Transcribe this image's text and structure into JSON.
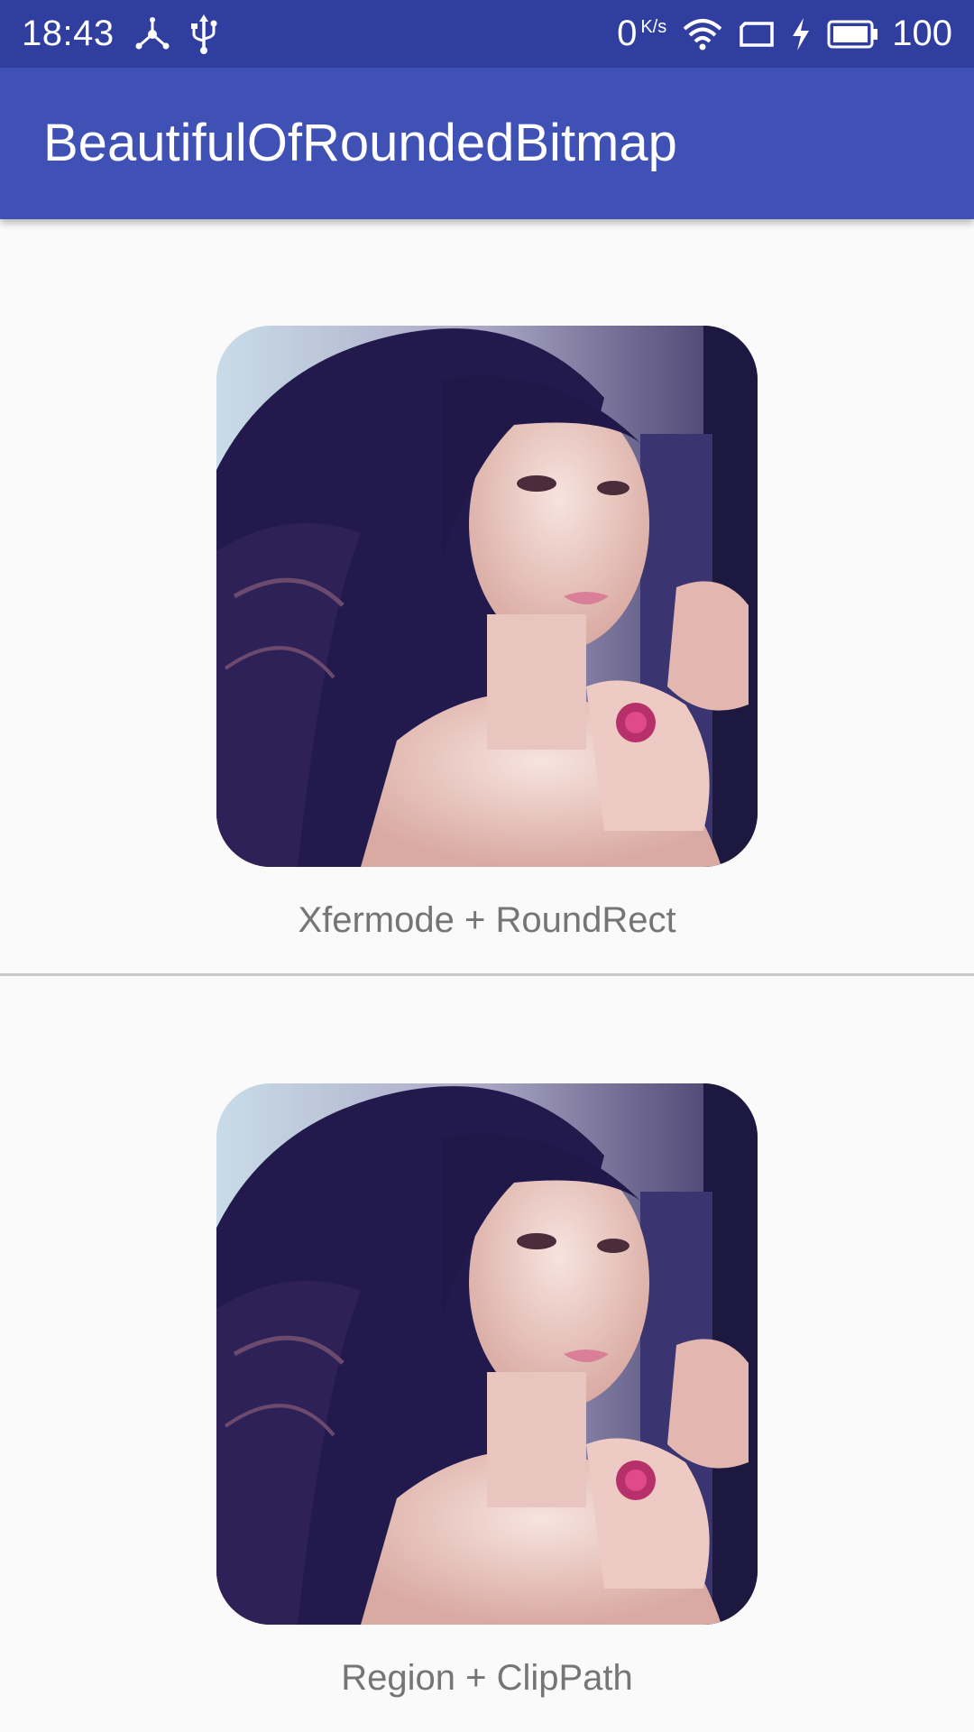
{
  "status_bar": {
    "time": "18:43",
    "net_speed_value": "0",
    "net_speed_unit": "K/s",
    "battery_percent": "100",
    "icons": [
      "usb-debug-icon",
      "usb-icon",
      "wifi-icon",
      "screen-rotate-icon",
      "charging-icon",
      "battery-icon"
    ],
    "colors": {
      "background": "#303f9f",
      "foreground": "#ffffff"
    }
  },
  "app_bar": {
    "title": "BeautifulOfRoundedBitmap",
    "color": "#3f51b5"
  },
  "main": {
    "items": [
      {
        "image_name": "rounded-portrait-image-xfermode",
        "caption": "Xfermode + RoundRect"
      },
      {
        "image_name": "rounded-portrait-image-clippath",
        "caption": "Region + ClipPath"
      }
    ],
    "caption_color": "#757575"
  }
}
